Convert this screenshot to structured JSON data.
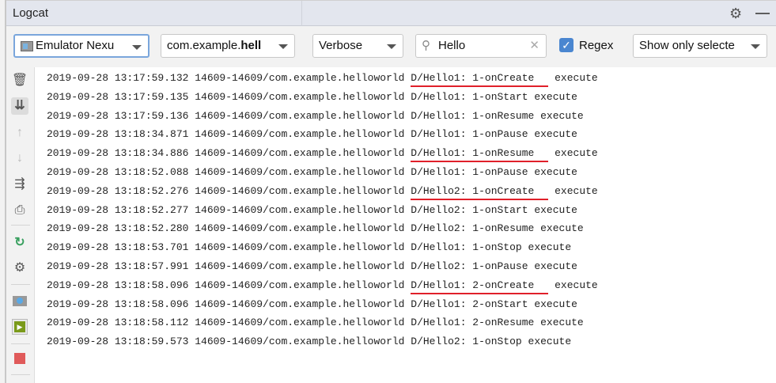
{
  "panel": {
    "title": "Logcat"
  },
  "toolbar": {
    "device": "Emulator Nexu",
    "process_prefix": "com.example.",
    "process_bold": "hell",
    "level": "Verbose",
    "search": "Hello",
    "regex_label": "Regex",
    "regex_checked": true,
    "filter": "Show only selecte"
  },
  "colors": {
    "underline": "#e0202a",
    "accent": "#4a86d0"
  },
  "log": [
    {
      "prefix": "2019-09-28 13:17:59.132 14609-14609/com.example.helloworld ",
      "msg": "D/Hello1: 1-onCreate",
      "rest": " execute",
      "hl": true
    },
    {
      "prefix": "2019-09-28 13:17:59.135 14609-14609/com.example.helloworld ",
      "msg": "D/Hello1: 1-onStart",
      "rest": " execute",
      "hl": false
    },
    {
      "prefix": "2019-09-28 13:17:59.136 14609-14609/com.example.helloworld ",
      "msg": "D/Hello1: 1-onResume",
      "rest": " execute",
      "hl": false
    },
    {
      "prefix": "2019-09-28 13:18:34.871 14609-14609/com.example.helloworld ",
      "msg": "D/Hello1: 1-onPause",
      "rest": " execute",
      "hl": false
    },
    {
      "prefix": "2019-09-28 13:18:34.886 14609-14609/com.example.helloworld ",
      "msg": "D/Hello1: 1-onResume",
      "rest": " execute",
      "hl": true
    },
    {
      "prefix": "2019-09-28 13:18:52.088 14609-14609/com.example.helloworld ",
      "msg": "D/Hello1: 1-onPause",
      "rest": " execute",
      "hl": false
    },
    {
      "prefix": "2019-09-28 13:18:52.276 14609-14609/com.example.helloworld ",
      "msg": "D/Hello2: 1-onCreate",
      "rest": " execute",
      "hl": true
    },
    {
      "prefix": "2019-09-28 13:18:52.277 14609-14609/com.example.helloworld ",
      "msg": "D/Hello2: 1-onStart",
      "rest": " execute",
      "hl": false
    },
    {
      "prefix": "2019-09-28 13:18:52.280 14609-14609/com.example.helloworld ",
      "msg": "D/Hello2: 1-onResume",
      "rest": " execute",
      "hl": false
    },
    {
      "prefix": "2019-09-28 13:18:53.701 14609-14609/com.example.helloworld ",
      "msg": "D/Hello1: 1-onStop",
      "rest": " execute",
      "hl": false
    },
    {
      "prefix": "2019-09-28 13:18:57.991 14609-14609/com.example.helloworld ",
      "msg": "D/Hello2: 1-onPause",
      "rest": " execute",
      "hl": false
    },
    {
      "prefix": "2019-09-28 13:18:58.096 14609-14609/com.example.helloworld ",
      "msg": "D/Hello1: 2-onCreate",
      "rest": " execute",
      "hl": true
    },
    {
      "prefix": "2019-09-28 13:18:58.096 14609-14609/com.example.helloworld ",
      "msg": "D/Hello1: 2-onStart",
      "rest": " execute",
      "hl": false
    },
    {
      "prefix": "2019-09-28 13:18:58.112 14609-14609/com.example.helloworld ",
      "msg": "D/Hello1: 2-onResume",
      "rest": " execute",
      "hl": false
    },
    {
      "prefix": "2019-09-28 13:18:59.573 14609-14609/com.example.helloworld ",
      "msg": "D/Hello2: 1-onStop",
      "rest": " execute",
      "hl": false
    }
  ]
}
